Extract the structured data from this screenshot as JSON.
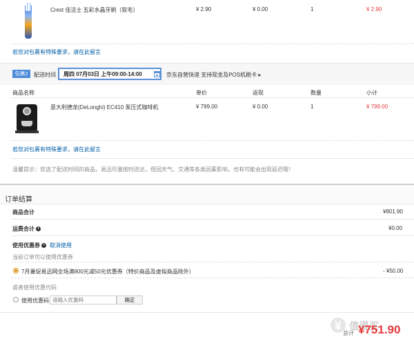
{
  "package1": {
    "item": {
      "name": "Crest 佳洁士 五彩水晶牙刷（软毛）",
      "price": "¥ 2.90",
      "discount": "¥ 0.00",
      "quantity": "1",
      "subtotal": "¥ 2.90"
    },
    "remark_link": "若您对包裹有特殊要求，请在此留言"
  },
  "package2": {
    "badge": "包裹2",
    "delivery_label": "配送时间",
    "delivery_date": "周四 07月03日 上午09:00-14:00",
    "shipping_note": "京东自营快递 支持现金及POS机刷卡 ▸",
    "headers": {
      "name": "商品名称",
      "price": "单价",
      "discount": "返现",
      "quantity": "数量",
      "subtotal": "小计"
    },
    "item": {
      "name": "意大利德龙(DeLonghi) EC410 泵压式咖啡机",
      "price": "¥ 799.00",
      "discount": "¥ 0.00",
      "quantity": "1",
      "subtotal": "¥ 799.00"
    },
    "remark_link": "若您对包裹有特殊要求，请在此留言"
  },
  "tip": "温馨提示：您选了配送时间的商品，易迅尽量按时送达，但因天气、交通等各类因素影响，也有可能会出现延迟哦！",
  "summary": {
    "title": "订单结算",
    "goods_total_label": "商品合计",
    "goods_total_value": "¥801.90",
    "shipping_label": "运费合计",
    "shipping_value": "¥0.00",
    "coupon_label": "使用优惠券",
    "cancel_link": "取消使用",
    "available_note": "当前订单可以使用优惠券",
    "coupon_option": "7月暑促易迅网全场满800元减50元优惠券（特价商品及虚拟商品除外）",
    "coupon_value": "- ¥50.00",
    "code_note": "或者使用优惠代码",
    "code_label": "使用优惠码",
    "code_placeholder": "请输入优惠码",
    "confirm_label": "确定"
  },
  "footer": {
    "total_label": "总计",
    "total_value": "¥751.90",
    "watermark_text": "值得买"
  },
  "colors": {
    "price_red": "#e4393c",
    "link_blue": "#005ea7",
    "badge_blue": "#4b8bd9",
    "radio_orange": "#d88d0a"
  }
}
